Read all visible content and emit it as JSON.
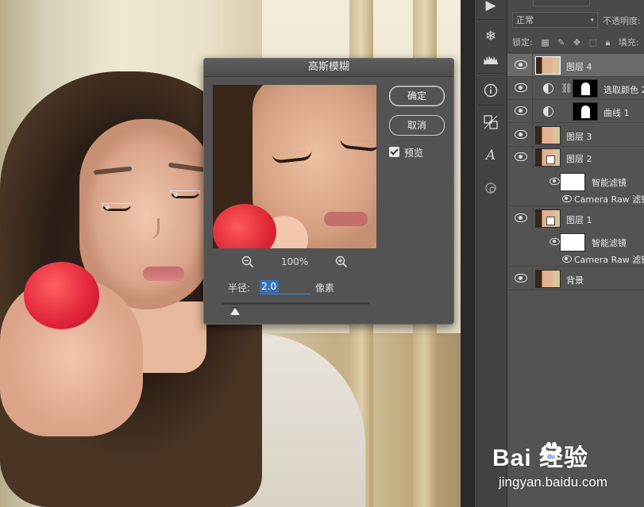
{
  "dialog": {
    "title": "高斯模糊",
    "ok_label": "确定",
    "cancel_label": "取消",
    "preview_label": "预览",
    "preview_checked": true,
    "zoom_percent": "100%",
    "radius_label": "半径:",
    "radius_value": "2.0",
    "radius_unit": "像素",
    "slider_fraction": 0.09
  },
  "toolbar": {
    "icons": [
      "play-icon",
      "snowflake-icon",
      "histogram-icon",
      "info-icon",
      "transform-icon",
      "glyph-icon",
      "paths-icon"
    ]
  },
  "layers_panel": {
    "blend_mode": "正常",
    "opacity_label": "不透明度:",
    "lock_label": "锁定:",
    "fill_label": "填充:",
    "layers": [
      {
        "name": "图层 4",
        "kind": "pixel",
        "selected": true
      },
      {
        "name": "选取颜色 2",
        "kind": "adjustment"
      },
      {
        "name": "曲线 1",
        "kind": "adjustment"
      },
      {
        "name": "图层 3",
        "kind": "pixel"
      },
      {
        "name": "图层 2",
        "kind": "smart"
      },
      {
        "name": "智能滤镜",
        "kind": "smart-filter"
      },
      {
        "name": "Camera Raw 滤镜",
        "kind": "filter"
      },
      {
        "name": "图层 1",
        "kind": "smart"
      },
      {
        "name": "智能滤镜",
        "kind": "smart-filter"
      },
      {
        "name": "Camera Raw 滤镜",
        "kind": "filter"
      },
      {
        "name": "背景",
        "kind": "pixel"
      }
    ]
  },
  "watermark": {
    "brand": "Bai  经验",
    "url": "jingyan.baidu.com"
  },
  "colors": {
    "accent": "#3b88d8",
    "dialog_bg": "#535353",
    "panel_bg": "#535353"
  }
}
